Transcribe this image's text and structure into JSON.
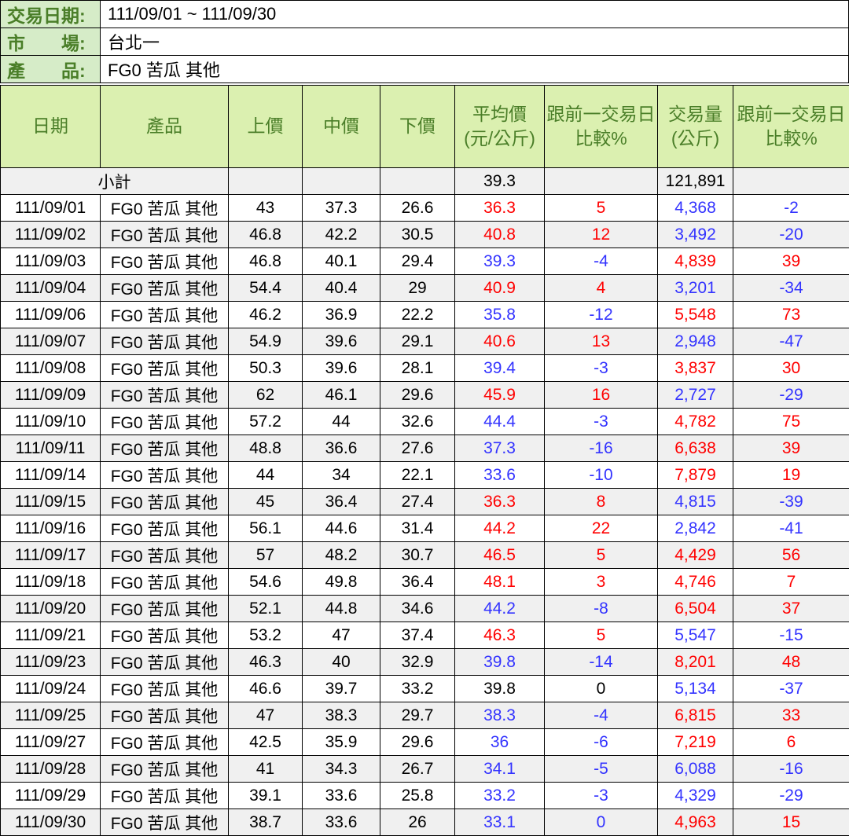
{
  "colors": {
    "up_trend": "#ff0000",
    "down_trend": "#3333ff",
    "flat_trend": "#000000",
    "header_text": "#4a7e28",
    "info_label_bg": "#d6ecc8",
    "header_bg": "#dbf0b0",
    "row_alt_bg": "#f0f0f0",
    "border": "#000000"
  },
  "info": {
    "rows": [
      {
        "label": "交易日期:",
        "value": "111/09/01 ~ 111/09/30"
      },
      {
        "label": "市　　場:",
        "value": "台北一"
      },
      {
        "label": "產　　品:",
        "value": "FG0 苦瓜 其他"
      }
    ]
  },
  "table": {
    "header": [
      {
        "line1": "日期",
        "line2": ""
      },
      {
        "line1": "產品",
        "line2": ""
      },
      {
        "line1": "上價",
        "line2": ""
      },
      {
        "line1": "中價",
        "line2": ""
      },
      {
        "line1": "下價",
        "line2": ""
      },
      {
        "line1": "平均價",
        "line2": "(元/公斤)"
      },
      {
        "line1": "跟前一交易日",
        "line2": "比較%"
      },
      {
        "line1": "交易量",
        "line2": "(公斤)"
      },
      {
        "line1": "跟前一交易日",
        "line2": "比較%"
      }
    ],
    "subtotal": {
      "label": "小計",
      "avg_price": "39.3",
      "volume": "121,891"
    },
    "rows": [
      {
        "date": "111/09/01",
        "product": "FG0 苦瓜 其他",
        "high": "43",
        "mid": "37.3",
        "low": "26.6",
        "avg": "36.3",
        "avg_chg": "5",
        "vol": "4,368",
        "vol_chg": "-2",
        "avg_trend": "up",
        "vol_trend": "down"
      },
      {
        "date": "111/09/02",
        "product": "FG0 苦瓜 其他",
        "high": "46.8",
        "mid": "42.2",
        "low": "30.5",
        "avg": "40.8",
        "avg_chg": "12",
        "vol": "3,492",
        "vol_chg": "-20",
        "avg_trend": "up",
        "vol_trend": "down"
      },
      {
        "date": "111/09/03",
        "product": "FG0 苦瓜 其他",
        "high": "46.8",
        "mid": "40.1",
        "low": "29.4",
        "avg": "39.3",
        "avg_chg": "-4",
        "vol": "4,839",
        "vol_chg": "39",
        "avg_trend": "down",
        "vol_trend": "up"
      },
      {
        "date": "111/09/04",
        "product": "FG0 苦瓜 其他",
        "high": "54.4",
        "mid": "40.4",
        "low": "29",
        "avg": "40.9",
        "avg_chg": "4",
        "vol": "3,201",
        "vol_chg": "-34",
        "avg_trend": "up",
        "vol_trend": "down"
      },
      {
        "date": "111/09/06",
        "product": "FG0 苦瓜 其他",
        "high": "46.2",
        "mid": "36.9",
        "low": "22.2",
        "avg": "35.8",
        "avg_chg": "-12",
        "vol": "5,548",
        "vol_chg": "73",
        "avg_trend": "down",
        "vol_trend": "up"
      },
      {
        "date": "111/09/07",
        "product": "FG0 苦瓜 其他",
        "high": "54.9",
        "mid": "39.6",
        "low": "29.1",
        "avg": "40.6",
        "avg_chg": "13",
        "vol": "2,948",
        "vol_chg": "-47",
        "avg_trend": "up",
        "vol_trend": "down"
      },
      {
        "date": "111/09/08",
        "product": "FG0 苦瓜 其他",
        "high": "50.3",
        "mid": "39.6",
        "low": "28.1",
        "avg": "39.4",
        "avg_chg": "-3",
        "vol": "3,837",
        "vol_chg": "30",
        "avg_trend": "down",
        "vol_trend": "up"
      },
      {
        "date": "111/09/09",
        "product": "FG0 苦瓜 其他",
        "high": "62",
        "mid": "46.1",
        "low": "29.6",
        "avg": "45.9",
        "avg_chg": "16",
        "vol": "2,727",
        "vol_chg": "-29",
        "avg_trend": "up",
        "vol_trend": "down"
      },
      {
        "date": "111/09/10",
        "product": "FG0 苦瓜 其他",
        "high": "57.2",
        "mid": "44",
        "low": "32.6",
        "avg": "44.4",
        "avg_chg": "-3",
        "vol": "4,782",
        "vol_chg": "75",
        "avg_trend": "down",
        "vol_trend": "up"
      },
      {
        "date": "111/09/11",
        "product": "FG0 苦瓜 其他",
        "high": "48.8",
        "mid": "36.6",
        "low": "27.6",
        "avg": "37.3",
        "avg_chg": "-16",
        "vol": "6,638",
        "vol_chg": "39",
        "avg_trend": "down",
        "vol_trend": "up"
      },
      {
        "date": "111/09/14",
        "product": "FG0 苦瓜 其他",
        "high": "44",
        "mid": "34",
        "low": "22.1",
        "avg": "33.6",
        "avg_chg": "-10",
        "vol": "7,879",
        "vol_chg": "19",
        "avg_trend": "down",
        "vol_trend": "up"
      },
      {
        "date": "111/09/15",
        "product": "FG0 苦瓜 其他",
        "high": "45",
        "mid": "36.4",
        "low": "27.4",
        "avg": "36.3",
        "avg_chg": "8",
        "vol": "4,815",
        "vol_chg": "-39",
        "avg_trend": "up",
        "vol_trend": "down"
      },
      {
        "date": "111/09/16",
        "product": "FG0 苦瓜 其他",
        "high": "56.1",
        "mid": "44.6",
        "low": "31.4",
        "avg": "44.2",
        "avg_chg": "22",
        "vol": "2,842",
        "vol_chg": "-41",
        "avg_trend": "up",
        "vol_trend": "down"
      },
      {
        "date": "111/09/17",
        "product": "FG0 苦瓜 其他",
        "high": "57",
        "mid": "48.2",
        "low": "30.7",
        "avg": "46.5",
        "avg_chg": "5",
        "vol": "4,429",
        "vol_chg": "56",
        "avg_trend": "up",
        "vol_trend": "up"
      },
      {
        "date": "111/09/18",
        "product": "FG0 苦瓜 其他",
        "high": "54.6",
        "mid": "49.8",
        "low": "36.4",
        "avg": "48.1",
        "avg_chg": "3",
        "vol": "4,746",
        "vol_chg": "7",
        "avg_trend": "up",
        "vol_trend": "up"
      },
      {
        "date": "111/09/20",
        "product": "FG0 苦瓜 其他",
        "high": "52.1",
        "mid": "44.8",
        "low": "34.6",
        "avg": "44.2",
        "avg_chg": "-8",
        "vol": "6,504",
        "vol_chg": "37",
        "avg_trend": "down",
        "vol_trend": "up"
      },
      {
        "date": "111/09/21",
        "product": "FG0 苦瓜 其他",
        "high": "53.2",
        "mid": "47",
        "low": "37.4",
        "avg": "46.3",
        "avg_chg": "5",
        "vol": "5,547",
        "vol_chg": "-15",
        "avg_trend": "up",
        "vol_trend": "down"
      },
      {
        "date": "111/09/23",
        "product": "FG0 苦瓜 其他",
        "high": "46.3",
        "mid": "40",
        "low": "32.9",
        "avg": "39.8",
        "avg_chg": "-14",
        "vol": "8,201",
        "vol_chg": "48",
        "avg_trend": "down",
        "vol_trend": "up"
      },
      {
        "date": "111/09/24",
        "product": "FG0 苦瓜 其他",
        "high": "46.6",
        "mid": "39.7",
        "low": "33.2",
        "avg": "39.8",
        "avg_chg": "0",
        "vol": "5,134",
        "vol_chg": "-37",
        "avg_trend": "flat",
        "vol_trend": "down"
      },
      {
        "date": "111/09/25",
        "product": "FG0 苦瓜 其他",
        "high": "47",
        "mid": "38.3",
        "low": "29.7",
        "avg": "38.3",
        "avg_chg": "-4",
        "vol": "6,815",
        "vol_chg": "33",
        "avg_trend": "down",
        "vol_trend": "up"
      },
      {
        "date": "111/09/27",
        "product": "FG0 苦瓜 其他",
        "high": "42.5",
        "mid": "35.9",
        "low": "29.6",
        "avg": "36",
        "avg_chg": "-6",
        "vol": "7,219",
        "vol_chg": "6",
        "avg_trend": "down",
        "vol_trend": "up"
      },
      {
        "date": "111/09/28",
        "product": "FG0 苦瓜 其他",
        "high": "41",
        "mid": "34.3",
        "low": "26.7",
        "avg": "34.1",
        "avg_chg": "-5",
        "vol": "6,088",
        "vol_chg": "-16",
        "avg_trend": "down",
        "vol_trend": "down"
      },
      {
        "date": "111/09/29",
        "product": "FG0 苦瓜 其他",
        "high": "39.1",
        "mid": "33.6",
        "low": "25.8",
        "avg": "33.2",
        "avg_chg": "-3",
        "vol": "4,329",
        "vol_chg": "-29",
        "avg_trend": "down",
        "vol_trend": "down"
      },
      {
        "date": "111/09/30",
        "product": "FG0 苦瓜 其他",
        "high": "38.7",
        "mid": "33.6",
        "low": "26",
        "avg": "33.1",
        "avg_chg": "0",
        "vol": "4,963",
        "vol_chg": "15",
        "avg_trend": "down",
        "vol_trend": "up"
      }
    ]
  }
}
